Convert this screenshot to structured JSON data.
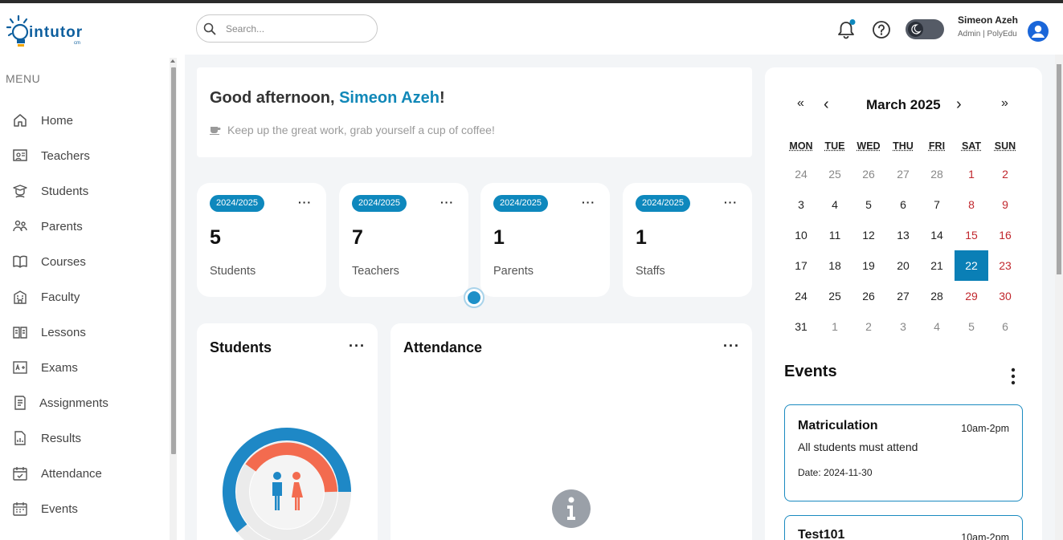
{
  "app": {
    "logo_text": "intutor",
    "logo_sub": "cm"
  },
  "header": {
    "search_placeholder": "Search...",
    "user_name": "Simeon Azeh",
    "user_role": "Admin | PolyEdu",
    "icons": [
      "bell-icon",
      "help-icon",
      "theme-toggle",
      "avatar-icon"
    ],
    "notification_dot_color": "#0e88bd"
  },
  "sidebar": {
    "menu_label": "MENU",
    "items": [
      {
        "label": "Home",
        "icon": "home-icon"
      },
      {
        "label": "Teachers",
        "icon": "teacher-icon"
      },
      {
        "label": "Students",
        "icon": "student-icon"
      },
      {
        "label": "Parents",
        "icon": "parents-icon"
      },
      {
        "label": "Courses",
        "icon": "book-icon"
      },
      {
        "label": "Faculty",
        "icon": "building-icon"
      },
      {
        "label": "Lessons",
        "icon": "lesson-icon"
      },
      {
        "label": "Exams",
        "icon": "exam-icon"
      },
      {
        "label": "Assignments",
        "icon": "assignment-icon"
      },
      {
        "label": "Results",
        "icon": "results-icon"
      },
      {
        "label": "Attendance",
        "icon": "calendar-icon"
      },
      {
        "label": "Events",
        "icon": "events-icon"
      }
    ]
  },
  "greeting": {
    "prefix": "Good afternoon, ",
    "name": "Simeon Azeh",
    "suffix": "!",
    "subtitle": "Keep up the great work, grab yourself a cup of coffee!"
  },
  "stats": [
    {
      "badge": "2024/2025",
      "value": "5",
      "label": "Students"
    },
    {
      "badge": "2024/2025",
      "value": "7",
      "label": "Teachers"
    },
    {
      "badge": "2024/2025",
      "value": "1",
      "label": "Parents"
    },
    {
      "badge": "2024/2025",
      "value": "1",
      "label": "Staffs"
    }
  ],
  "panels": {
    "students_title": "Students",
    "attendance_title": "Attendance",
    "more": "···"
  },
  "colors": {
    "accent": "#0e88bd",
    "female": "#f36b4f",
    "male": "#1e88c6",
    "weekend": "#c1272d"
  },
  "calendar": {
    "month": "March 2025",
    "nav": {
      "prev_year": "«",
      "prev": "‹",
      "next": "›",
      "next_year": "»"
    },
    "weekdays": [
      "MON",
      "TUE",
      "WED",
      "THU",
      "FRI",
      "SAT",
      "SUN"
    ],
    "weeks": [
      [
        "24",
        "25",
        "26",
        "27",
        "28",
        "1",
        "2"
      ],
      [
        "3",
        "4",
        "5",
        "6",
        "7",
        "8",
        "9"
      ],
      [
        "10",
        "11",
        "12",
        "13",
        "14",
        "15",
        "16"
      ],
      [
        "17",
        "18",
        "19",
        "20",
        "21",
        "22",
        "23"
      ],
      [
        "24",
        "25",
        "26",
        "27",
        "28",
        "29",
        "30"
      ],
      [
        "31",
        "1",
        "2",
        "3",
        "4",
        "5",
        "6"
      ]
    ],
    "today": "22"
  },
  "events": {
    "title": "Events",
    "items": [
      {
        "title": "Matriculation",
        "time": "10am-2pm",
        "desc": "All students must attend",
        "date": "Date: 2024-11-30"
      },
      {
        "title": "Test101",
        "time": "10am-2pm",
        "desc": "",
        "date": ""
      }
    ]
  }
}
